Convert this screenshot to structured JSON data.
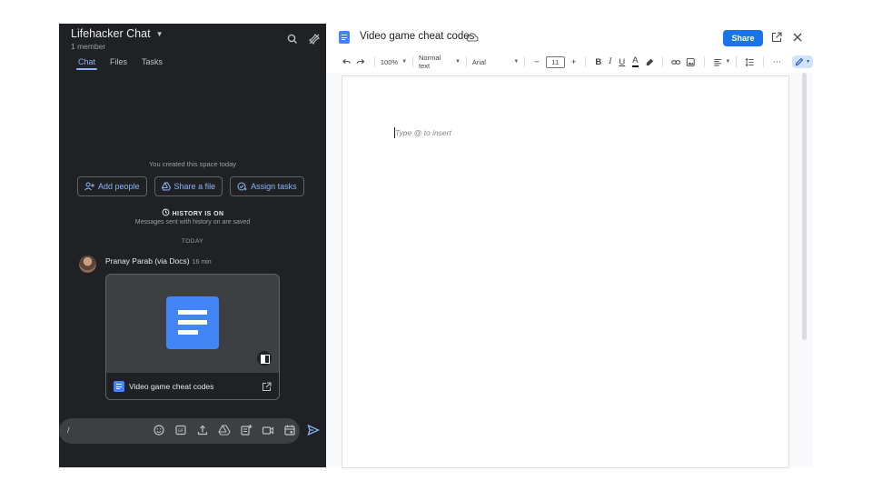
{
  "chat": {
    "space_title": "Lifehacker Chat",
    "member_count": "1 member",
    "tabs": [
      {
        "label": "Chat",
        "active": true
      },
      {
        "label": "Files",
        "active": false
      },
      {
        "label": "Tasks",
        "active": false
      }
    ],
    "created_notice": "You created this space today",
    "actions": [
      {
        "label": "Add people",
        "icon": "add-person-icon"
      },
      {
        "label": "Share a file",
        "icon": "drive-icon"
      },
      {
        "label": "Assign tasks",
        "icon": "assign-task-icon"
      }
    ],
    "history_title": "HISTORY IS ON",
    "history_sub": "Messages sent with history on are saved",
    "date_divider": "TODAY",
    "message": {
      "sender": "Pranay Parab (via Docs)",
      "time": "16 min",
      "attachment_name": "Video game cheat codes"
    },
    "composer": {
      "value": "/",
      "icons": [
        "emoji-icon",
        "gif-icon",
        "upload-icon",
        "drive-icon",
        "add-doc-icon",
        "video-meet-icon",
        "calendar-icon"
      ]
    }
  },
  "docs": {
    "title": "Video game cheat codes",
    "share_label": "Share",
    "toolbar": {
      "zoom": "100%",
      "style": "Normal text",
      "font": "Arial",
      "font_size": "11",
      "minus": "−",
      "plus": "+",
      "bold": "B",
      "italic": "I",
      "underline": "U",
      "text_color": "A",
      "more": "⋯"
    },
    "placeholder": "Type @ to insert"
  },
  "colors": {
    "chat_bg": "#202124",
    "accent_blue": "#8ab4f8",
    "share_blue": "#1a73e8",
    "docs_blue": "#4285f4"
  }
}
